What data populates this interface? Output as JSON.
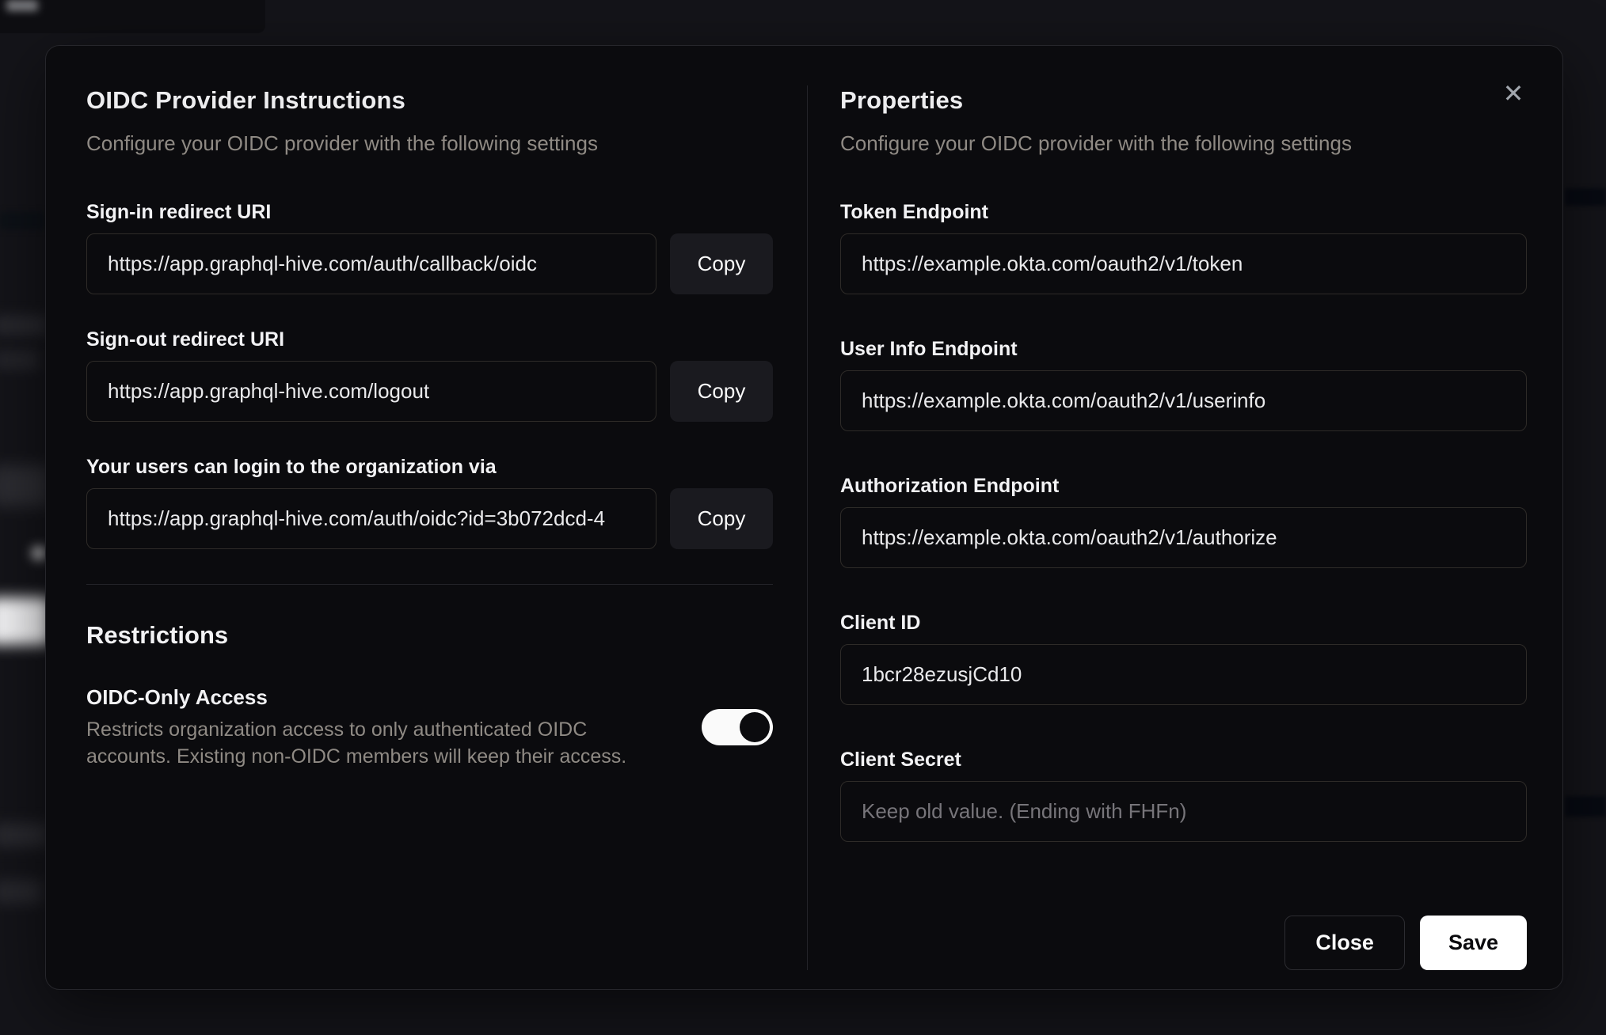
{
  "colors": {
    "page_bg": "#141419",
    "modal_bg": "#0b0b0e",
    "modal_border": "#26262b",
    "input_border": "#2e2b28",
    "divider": "#242429",
    "text_primary": "#ededef",
    "text_muted": "#8f8a84",
    "input_text": "#e9e9eb",
    "placeholder": "#77757a",
    "copy_bg": "#1a1a1f",
    "toggle_track": "#fafafa",
    "toggle_thumb": "#0b0b0e",
    "save_bg": "#ffffff",
    "save_text": "#0b0b0e",
    "close_border": "#2c2c31"
  },
  "modal": {
    "close_icon": "✕",
    "left": {
      "title": "OIDC Provider Instructions",
      "subtitle": "Configure your OIDC provider with the following settings",
      "copy_fields": [
        {
          "label": "Sign-in redirect URI",
          "value": "https://app.graphql-hive.com/auth/callback/oidc",
          "button": "Copy"
        },
        {
          "label": "Sign-out redirect URI",
          "value": "https://app.graphql-hive.com/logout",
          "button": "Copy"
        },
        {
          "label": "Your users can login to the organization via",
          "value": "https://app.graphql-hive.com/auth/oidc?id=3b072dcd-4",
          "button": "Copy"
        }
      ],
      "restrictions": {
        "title": "Restrictions",
        "setting_label": "OIDC-Only Access",
        "setting_description": "Restricts organization access to only authenticated OIDC accounts. Existing non-OIDC members will keep their access.",
        "toggle_state": "on"
      }
    },
    "right": {
      "title": "Properties",
      "subtitle": "Configure your OIDC provider with the following settings",
      "fields": [
        {
          "label": "Token Endpoint",
          "value": "https://example.okta.com/oauth2/v1/token",
          "placeholder": ""
        },
        {
          "label": "User Info Endpoint",
          "value": "https://example.okta.com/oauth2/v1/userinfo",
          "placeholder": ""
        },
        {
          "label": "Authorization Endpoint",
          "value": "https://example.okta.com/oauth2/v1/authorize",
          "placeholder": ""
        },
        {
          "label": "Client ID",
          "value": "1bcr28ezusjCd10",
          "placeholder": ""
        },
        {
          "label": "Client Secret",
          "value": "",
          "placeholder": "Keep old value. (Ending with FHFn)"
        }
      ],
      "actions": {
        "close_label": "Close",
        "save_label": "Save"
      }
    }
  }
}
